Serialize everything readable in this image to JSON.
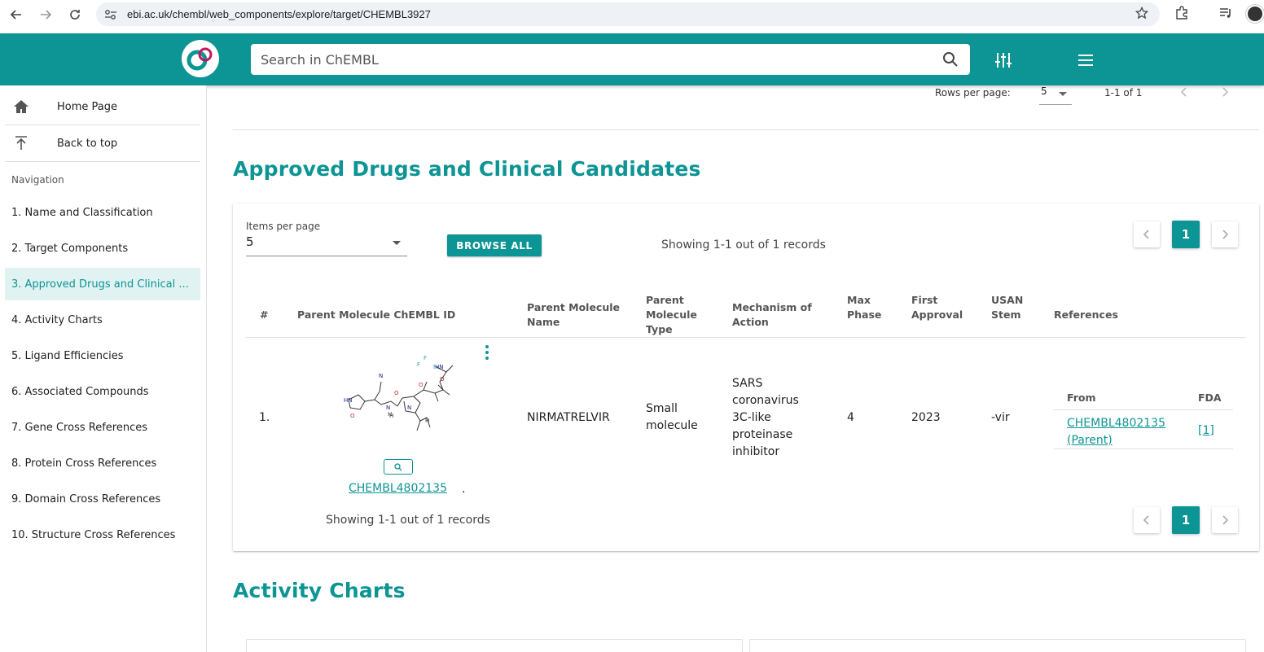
{
  "browser": {
    "url": "ebi.ac.uk/chembl/web_components/explore/target/CHEMBL3927"
  },
  "header": {
    "search_placeholder": "Search in ChEMBL",
    "brand_color": "#0d9494"
  },
  "sidebar": {
    "top_items": [
      {
        "label": "Home Page",
        "icon": "home-icon"
      },
      {
        "label": "Back to top",
        "icon": "arrow-to-top-icon"
      }
    ],
    "nav_heading": "Navigation",
    "items": [
      {
        "label": "1. Name and Classification"
      },
      {
        "label": "2. Target Components"
      },
      {
        "label": "3. Approved Drugs and Clinical ..."
      },
      {
        "label": "4. Activity Charts"
      },
      {
        "label": "5. Ligand Efficiencies"
      },
      {
        "label": "6. Associated Compounds"
      },
      {
        "label": "7. Gene Cross References"
      },
      {
        "label": "8. Protein Cross References"
      },
      {
        "label": "9. Domain Cross References"
      },
      {
        "label": "10. Structure Cross References"
      }
    ],
    "active_index": 2
  },
  "top_pager": {
    "rows_per_page_label": "Rows per page:",
    "rows_per_page_value": "5",
    "range": "1-1 of 1"
  },
  "approved_drugs": {
    "title": "Approved Drugs and Clinical Candidates",
    "items_per_page_label": "Items per page",
    "items_per_page_value": "5",
    "browse_all": "BROWSE ALL",
    "showing": "Showing 1-1 out of 1 records",
    "current_page": "1",
    "columns": [
      "#",
      "Parent Molecule ChEMBL ID",
      "Parent Molecule Name",
      "Parent Molecule Type",
      "Mechanism of Action",
      "Max Phase",
      "First Approval",
      "USAN Stem",
      "References"
    ],
    "rows": [
      {
        "index": "1.",
        "chembl_id": "CHEMBL4802135",
        "name": "NIRMATRELVIR",
        "type": "Small molecule",
        "mechanism": "SARS coronavirus 3C-like proteinase inhibitor",
        "max_phase": "4",
        "first_approval": "2023",
        "usan_stem": "-vir",
        "references": {
          "headers": [
            "From",
            "FDA"
          ],
          "from": "CHEMBL4802135 (Parent)",
          "fda": "[1]"
        }
      }
    ]
  },
  "activity_charts": {
    "title": "Activity Charts"
  }
}
